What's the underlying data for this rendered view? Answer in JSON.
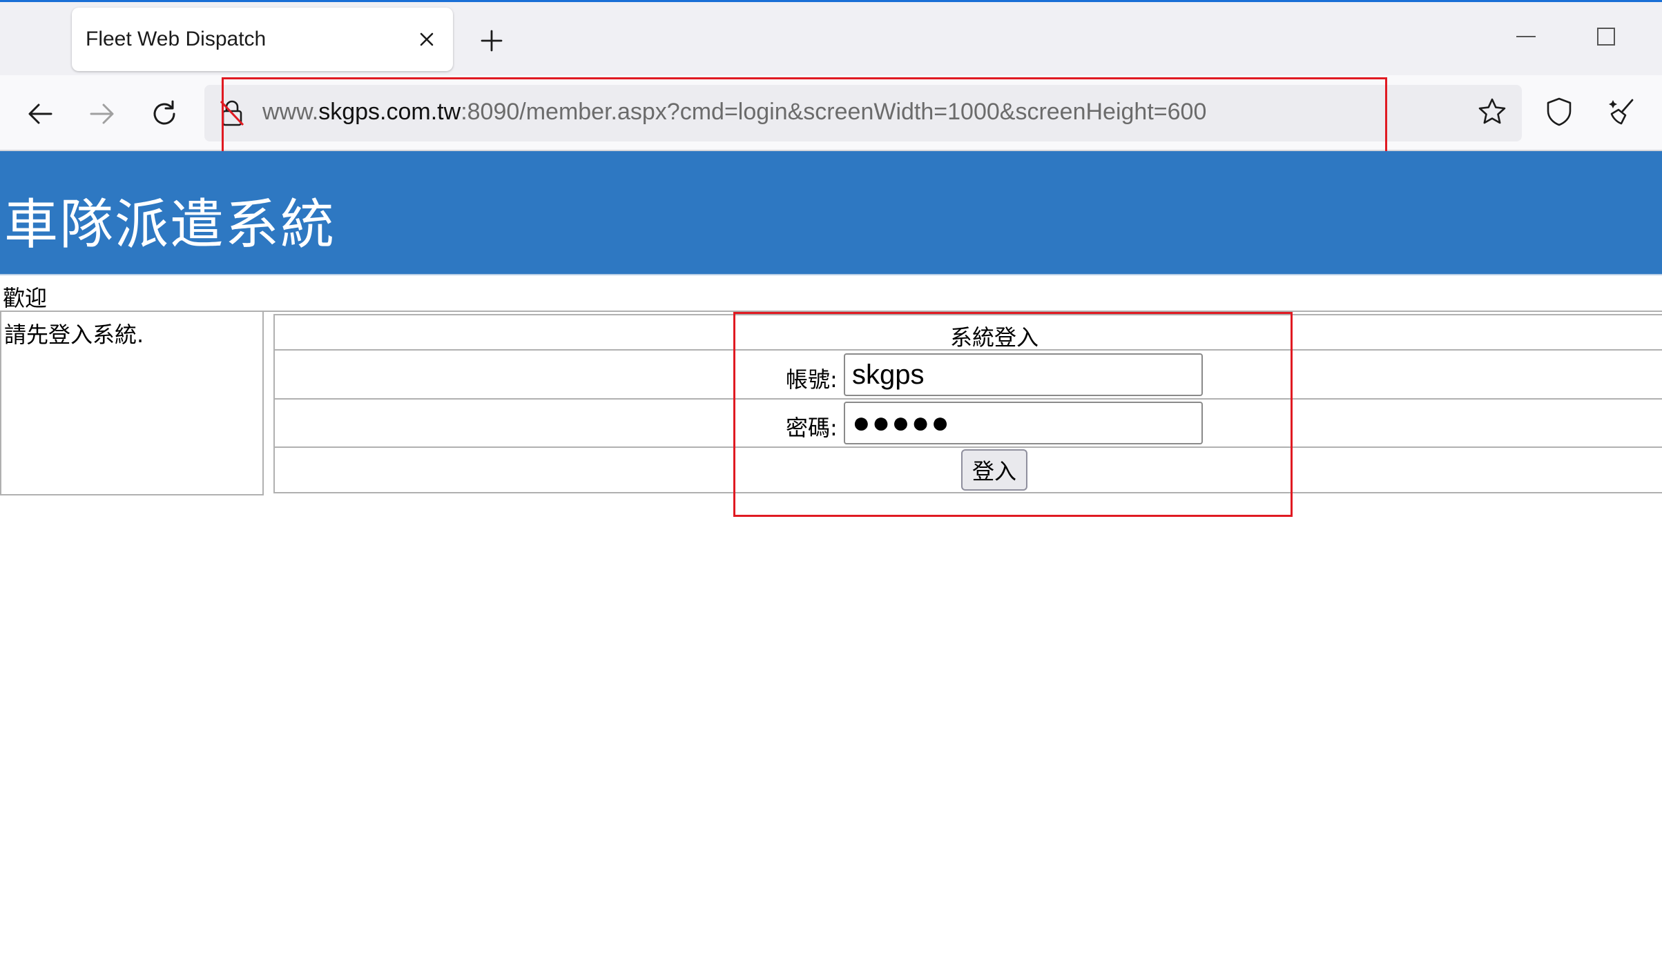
{
  "browser": {
    "tab_title": "Fleet Web Dispatch",
    "url_prefix": "www.",
    "url_host": "skgps.com.tw",
    "url_rest": ":8090/member.aspx?cmd=login&screenWidth=1000&screenHeight=600",
    "icons": [
      "close-icon",
      "plus-icon",
      "minimize-icon",
      "maximize-icon",
      "back-arrow-icon",
      "forward-arrow-icon",
      "reload-icon",
      "insecure-lock-icon",
      "star-icon",
      "shield-icon",
      "sweep-icon"
    ]
  },
  "page": {
    "banner_title": "車隊派遣系統",
    "welcome": "歡迎",
    "left_message": "請先登入系統.",
    "login": {
      "title": "系統登入",
      "account_label": "帳號:",
      "account_value": "skgps",
      "password_label": "密碼:",
      "password_value": "●●●●●",
      "submit_label": "登入"
    }
  },
  "colors": {
    "banner": "#2e78c2",
    "highlight": "#e01a22",
    "tabbar": "#f0f0f4"
  }
}
